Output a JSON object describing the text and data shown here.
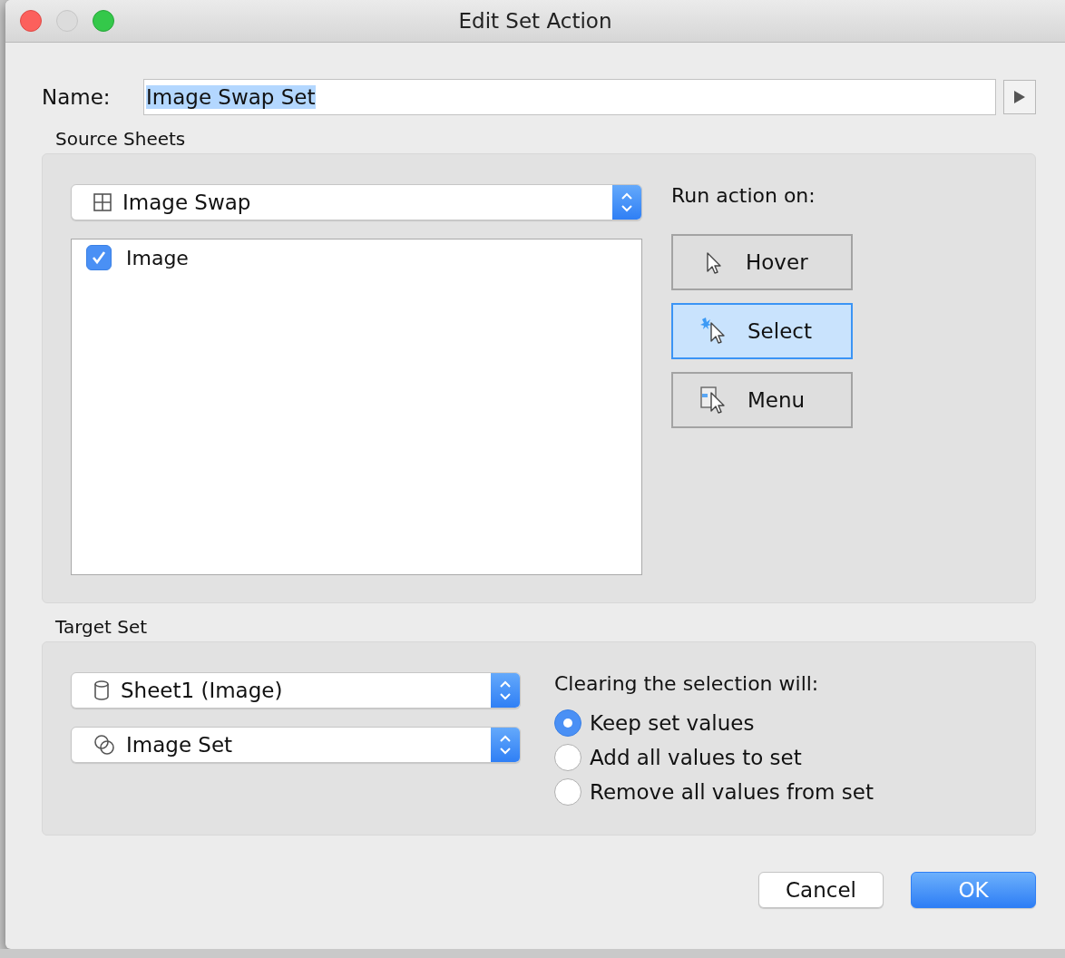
{
  "window": {
    "title": "Edit Set Action"
  },
  "name_field": {
    "label": "Name:",
    "value": "Image Swap Set",
    "highlighted": true
  },
  "source_sheets": {
    "title": "Source Sheets",
    "dropdown": {
      "kind": "sheet",
      "value": "Image Swap"
    },
    "sheets": [
      {
        "label": "Image",
        "checked": true
      }
    ],
    "run_action": {
      "title": "Run action on:",
      "options": [
        {
          "label": "Hover",
          "kind": "hover",
          "selected": false
        },
        {
          "label": "Select",
          "kind": "select",
          "selected": true
        },
        {
          "label": "Menu",
          "kind": "menu",
          "selected": false
        }
      ]
    }
  },
  "target_set": {
    "title": "Target Set",
    "dropdowns": [
      {
        "kind": "datasource",
        "value": "Sheet1 (Image)"
      },
      {
        "kind": "set",
        "value": "Image Set"
      }
    ],
    "clearing": {
      "title": "Clearing the selection will:",
      "options": [
        {
          "label": "Keep set values",
          "selected": true
        },
        {
          "label": "Add all values to set",
          "selected": false
        },
        {
          "label": "Remove all values from set",
          "selected": false
        }
      ]
    }
  },
  "buttons": [
    {
      "label": "Cancel",
      "kind": "normal"
    },
    {
      "label": "OK",
      "kind": "default"
    }
  ]
}
